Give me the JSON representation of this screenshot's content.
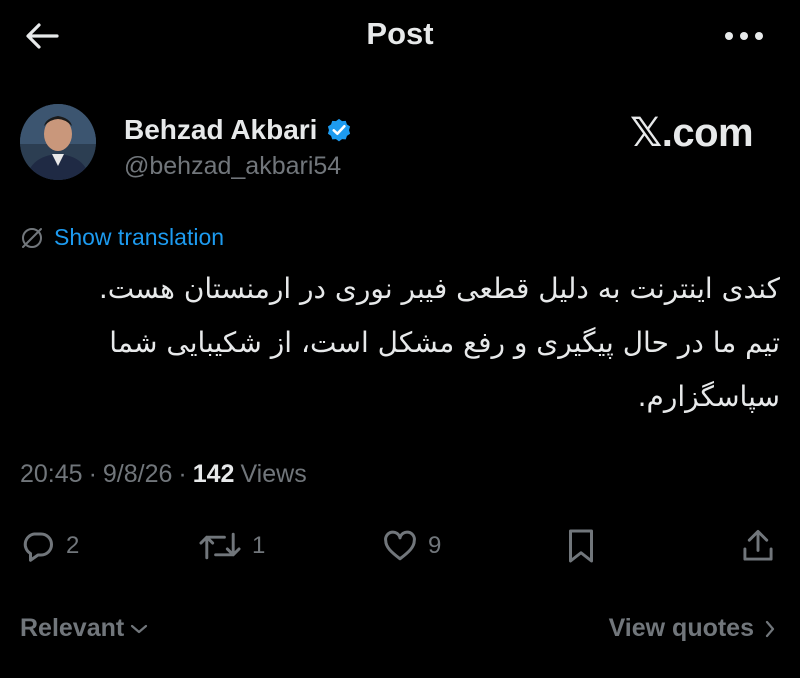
{
  "header": {
    "title": "Post"
  },
  "author": {
    "name": "Behzad Akbari",
    "handle": "@behzad_akbari54",
    "verified": true
  },
  "watermark": "𝕏.com",
  "translation": {
    "label": "Show translation"
  },
  "post": {
    "text": "کندی اینترنت به دلیل قطعی فیبر نوری در ارمنستان هست. تیم ما در حال پیگیری و رفع مشکل است، از شکیبایی شما سپاسگزارم."
  },
  "meta": {
    "time": "20:45",
    "date": "9/8/26",
    "views_count": "142",
    "views_label": "Views"
  },
  "actions": {
    "replies": "2",
    "reposts": "1",
    "likes": "9"
  },
  "footer": {
    "sort_label": "Relevant",
    "view_quotes_label": "View quotes"
  },
  "colors": {
    "background": "#000000",
    "text": "#e7e9ea",
    "muted": "#71767b",
    "accent": "#1d9bf0"
  }
}
